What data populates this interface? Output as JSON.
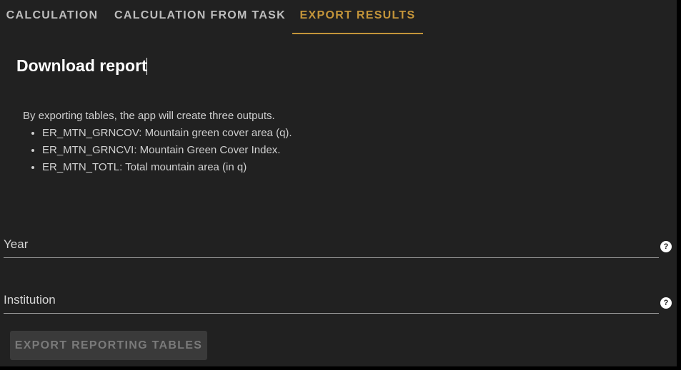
{
  "tabs": [
    {
      "label": "CALCULATION"
    },
    {
      "label": "CALCULATION FROM TASK"
    },
    {
      "label": "EXPORT RESULTS"
    }
  ],
  "active_tab": "EXPORT RESULTS",
  "title": "Download report",
  "intro": "By exporting tables, the app will create three outputs.",
  "outputs": [
    "ER_MTN_GRNCOV: Mountain green cover area (q).",
    "ER_MTN_GRNCVI: Mountain Green Cover Index.",
    "ER_MTN_TOTL: Total mountain area (in q)"
  ],
  "fields": {
    "year": {
      "label": "Year",
      "value": ""
    },
    "institution": {
      "label": "Institution",
      "value": ""
    }
  },
  "help_icon": "?",
  "export_button": {
    "label": "EXPORT REPORTING TABLES",
    "disabled": true
  },
  "colors": {
    "background": "#212121",
    "accent": "#c4953a",
    "text": "#d0d0d0",
    "button_disabled_bg": "#3a3a3a"
  }
}
